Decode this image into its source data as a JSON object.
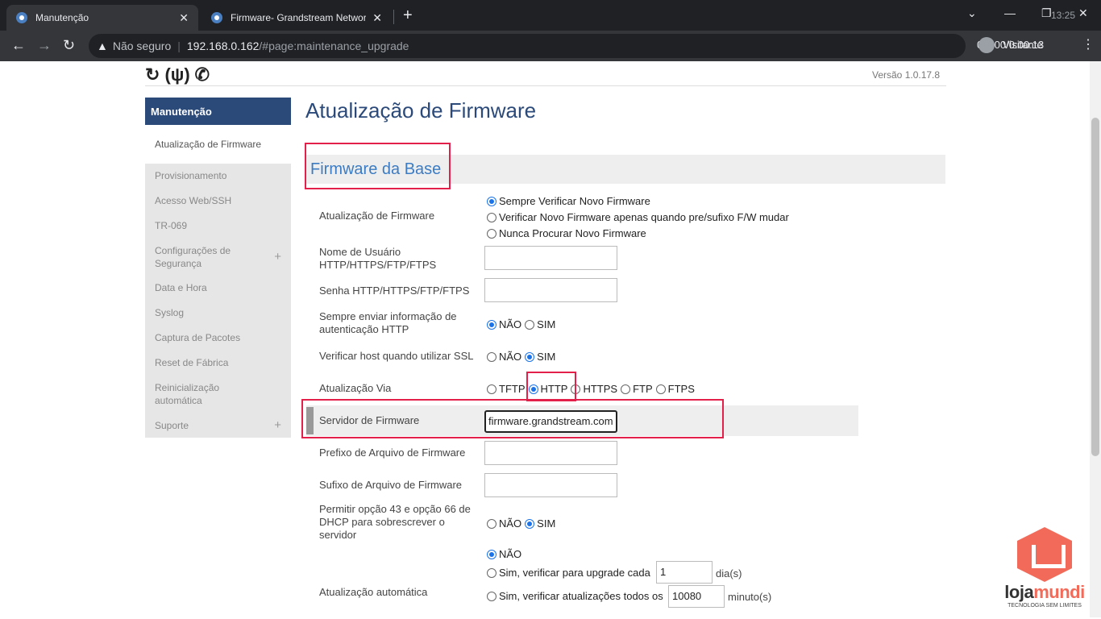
{
  "browser": {
    "tabs": [
      {
        "label": "Manutenção",
        "close": "✕"
      },
      {
        "label": "Firmware- Grandstream Network",
        "close": "✕"
      }
    ],
    "new_tab": "+",
    "clock": "13:25",
    "security_label": "Não seguro",
    "url_host": "192.168.0.162",
    "url_path": "/#page:maintenance_upgrade",
    "right_overlay": "0:0:00/0:00:13",
    "profile": "Visitante"
  },
  "header": {
    "version": "Versão 1.0.17.8"
  },
  "sidebar": {
    "title": "Manutenção",
    "items": [
      {
        "label": "Atualização de Firmware",
        "active": true
      },
      {
        "label": "Provisionamento"
      },
      {
        "label": "Acesso Web/SSH"
      },
      {
        "label": "TR-069"
      },
      {
        "label": "Configurações de Segurança",
        "expand": "+"
      },
      {
        "label": "Data e Hora"
      },
      {
        "label": "Syslog"
      },
      {
        "label": "Captura de Pacotes"
      },
      {
        "label": "Reset de Fábrica"
      },
      {
        "label": "Reinicialização automática"
      },
      {
        "label": "Suporte",
        "expand": "+"
      }
    ]
  },
  "main": {
    "title": "Atualização de Firmware",
    "section": "Firmware da Base",
    "fw_update": {
      "label": "Atualização de Firmware",
      "options": [
        "Sempre Verificar Novo Firmware",
        "Verificar Novo Firmware apenas quando pre/sufixo F/W mudar",
        "Nunca Procurar Novo Firmware"
      ],
      "selected": 0
    },
    "username": {
      "label": "Nome de Usuário HTTP/HTTPS/FTP/FTPS",
      "value": ""
    },
    "password": {
      "label": "Senha HTTP/HTTPS/FTP/FTPS",
      "value": ""
    },
    "send_auth": {
      "label": "Sempre enviar informação de autenticação HTTP",
      "no": "NÃO",
      "yes": "SIM",
      "selected": "no"
    },
    "verify_ssl": {
      "label": "Verificar host quando utilizar SSL",
      "no": "NÃO",
      "yes": "SIM",
      "selected": "yes"
    },
    "upgrade_via": {
      "label": "Atualização Via",
      "options": [
        "TFTP",
        "HTTP",
        "HTTPS",
        "FTP",
        "FTPS"
      ],
      "selected": "HTTP"
    },
    "server": {
      "label": "Servidor de Firmware",
      "value": "firmware.grandstream.com"
    },
    "prefix": {
      "label": "Prefixo de Arquivo de Firmware",
      "value": ""
    },
    "suffix": {
      "label": "Sufixo de Arquivo de Firmware",
      "value": ""
    },
    "dhcp_override": {
      "label": "Permitir opção 43 e opção 66 de DHCP para sobrescrever o servidor",
      "no": "NÃO",
      "yes": "SIM",
      "selected": "yes"
    },
    "auto_update": {
      "label": "Atualização automática",
      "no": "NÃO",
      "days_prefix": "Sim, verificar para upgrade cada",
      "days_value": "1",
      "days_unit": "dia(s)",
      "minutes_prefix": "Sim, verificar atualizações todos os",
      "minutes_value": "10080",
      "minutes_unit": "minuto(s)"
    }
  },
  "watermark": {
    "name_a": "loja",
    "name_b": "mundi",
    "tagline": "TECNOLOGIA SEM LIMITES"
  }
}
